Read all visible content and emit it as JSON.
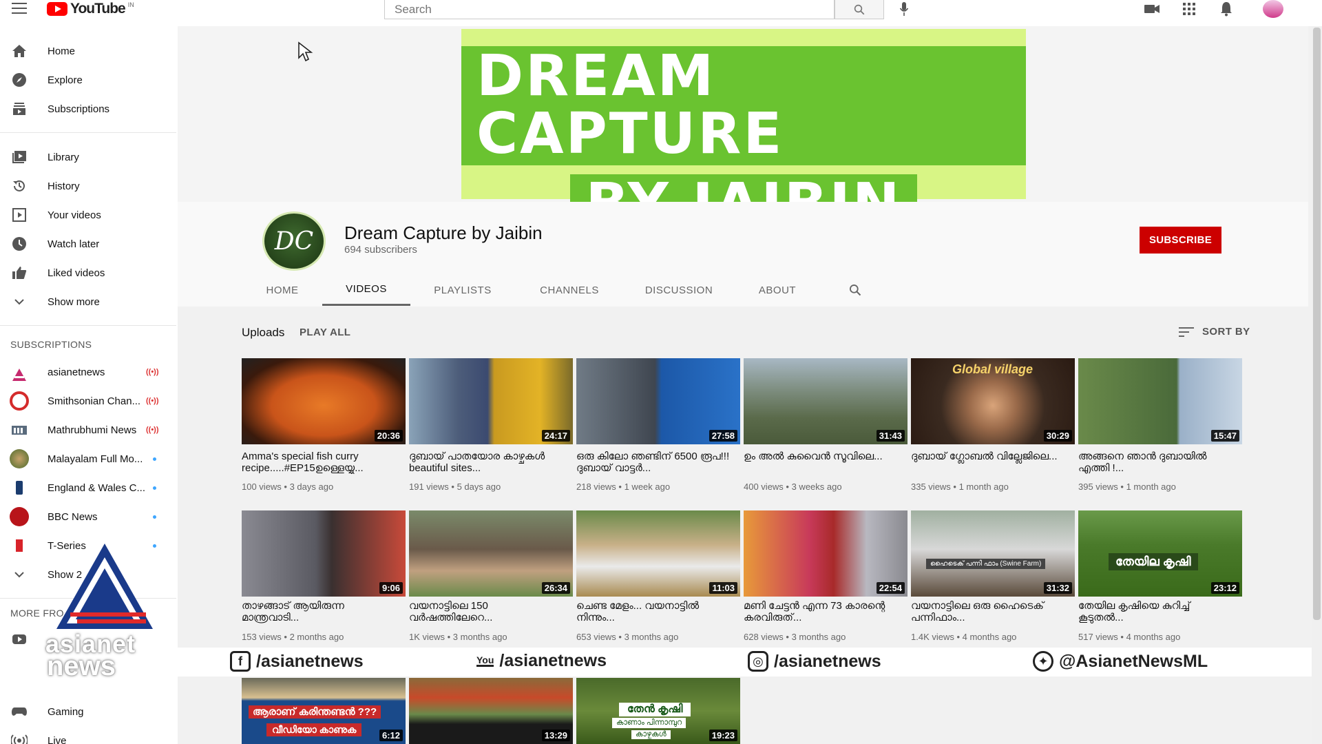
{
  "topbar": {
    "logo_text": "YouTube",
    "logo_country": "IN",
    "search_placeholder": "Search"
  },
  "sidebar": {
    "main_items": [
      {
        "label": "Home",
        "icon": "home-icon"
      },
      {
        "label": "Explore",
        "icon": "compass-icon"
      },
      {
        "label": "Subscriptions",
        "icon": "subscriptions-icon"
      }
    ],
    "library_items": [
      {
        "label": "Library",
        "icon": "library-icon"
      },
      {
        "label": "History",
        "icon": "history-icon"
      },
      {
        "label": "Your videos",
        "icon": "your-videos-icon"
      },
      {
        "label": "Watch later",
        "icon": "clock-icon"
      },
      {
        "label": "Liked videos",
        "icon": "thumbs-up-icon"
      },
      {
        "label": "Show more",
        "icon": "chevron-down-icon"
      }
    ],
    "subscriptions_header": "SUBSCRIPTIONS",
    "subscriptions": [
      {
        "label": "asianetnews",
        "status": "live"
      },
      {
        "label": "Smithsonian Chan...",
        "status": "live"
      },
      {
        "label": "Mathrubhumi News",
        "status": "live"
      },
      {
        "label": "Malayalam Full Mo...",
        "status": "new"
      },
      {
        "label": "England & Wales C...",
        "status": "new"
      },
      {
        "label": "BBC News",
        "status": "new"
      },
      {
        "label": "T-Series",
        "status": "new"
      }
    ],
    "show_more_subs": "Show 2",
    "more_header": "MORE FRO",
    "bottom_items": [
      {
        "label": "Gaming",
        "icon": "gaming-icon"
      },
      {
        "label": "Live",
        "icon": "live-icon"
      }
    ]
  },
  "banner": {
    "line1": "DREAM CAPTURE",
    "line2": "BY JAIBIN"
  },
  "channel": {
    "avatar_text": "DC",
    "name": "Dream Capture by Jaibin",
    "subscribers": "694 subscribers",
    "subscribe_label": "SUBSCRIBE"
  },
  "tabs": [
    {
      "label": "HOME",
      "active": false
    },
    {
      "label": "VIDEOS",
      "active": true
    },
    {
      "label": "PLAYLISTS",
      "active": false
    },
    {
      "label": "CHANNELS",
      "active": false
    },
    {
      "label": "DISCUSSION",
      "active": false
    },
    {
      "label": "ABOUT",
      "active": false
    }
  ],
  "uploads": {
    "label": "Uploads",
    "play_all": "PLAY ALL",
    "sort_by": "SORT BY"
  },
  "videos": [
    {
      "title": "Amma's special fish curry recipe.....#EP15ഉള്ളെയ്യു...",
      "meta": "100 views • 3 days ago",
      "duration": "20:36"
    },
    {
      "title": "ദുബായ് പാതയോര കാഴ്ചകൾ beautiful sites...",
      "meta": "191 views • 5 days ago",
      "duration": "24:17"
    },
    {
      "title": "ഒരു കിലോ ഞണ്ടിന് 6500 രൂപ!!!ദുബായ് വാട്ടർ...",
      "meta": "218 views • 1 week ago",
      "duration": "27:58"
    },
    {
      "title": "ഉം അൽ കുവൈൻ സൂവിലെ...",
      "meta": "400 views • 3 weeks ago",
      "duration": "31:43"
    },
    {
      "title": "ദുബായ് ഗ്ലോബൽ വില്ലേജിലെ...",
      "meta": "335 views • 1 month ago",
      "duration": "30:29"
    },
    {
      "title": "അങ്ങനെ ഞാൻ ദുബായിൽ എത്തി !...",
      "meta": "395 views • 1 month ago",
      "duration": "15:47"
    },
    {
      "title": "താഴങ്ങാട് ആയിരുന്ന മാന്ത്രവാടി...",
      "meta": "153 views • 2 months ago",
      "duration": "9:06"
    },
    {
      "title": "വയനാട്ടിലെ 150 വർഷത്തിലേറെ...",
      "meta": "1K views • 3 months ago",
      "duration": "26:34"
    },
    {
      "title": "ചെണ്ട മേളം... വയനാട്ടിൽ നിന്നും...",
      "meta": "653 views • 3 months ago",
      "duration": "11:03"
    },
    {
      "title": "മണി ചേട്ടൻ എന്ന 73 കാരന്റെ കരവിരുത്...",
      "meta": "628 views • 3 months ago",
      "duration": "22:54"
    },
    {
      "title": "വയനാട്ടിലെ ഒരു ഹൈടെക് പന്നിഫാം...",
      "meta": "1.4K views • 4 months ago",
      "duration": "31:32"
    },
    {
      "title": "തേയില കൃഷിയെ കുറിച്ച് കൂടുതൽ...",
      "meta": "517 views • 4 months ago",
      "duration": "23:12"
    },
    {
      "title": "",
      "meta": "",
      "duration": "6:12"
    },
    {
      "title": "",
      "meta": "",
      "duration": "13:29"
    },
    {
      "title": "",
      "meta": "",
      "duration": "19:23"
    }
  ],
  "thumb_texts": {
    "v11": "ഹൈടെക് പന്നി ഫാം (Swine Farm)",
    "v12": "തേയില കൃഷി",
    "v13_a": "ആരാണ് കരിന്തണ്ടൻ ???",
    "v13_b": "വീഡിയോ കാണുക",
    "v15_a": "തേൻ കൃഷി",
    "v15_b": "കാണാം പിന്നാമ്പുറ",
    "v15_c": "കാഴ്ചകൾ",
    "v2": "Global village"
  },
  "overlay": {
    "brand_line1": "asianet",
    "brand_line2": "news",
    "facebook": "/asianetnews",
    "youtube": "/asianetnews",
    "youtube_badge": "You",
    "instagram": "/asianetnews",
    "twitter": "@AsianetNewsML"
  }
}
